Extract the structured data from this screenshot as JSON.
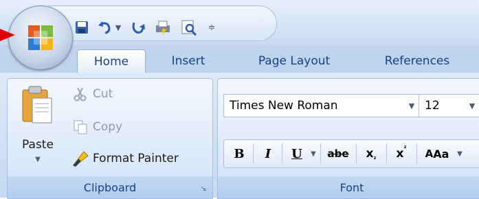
{
  "qat": {
    "save_icon": "save-icon",
    "undo_icon": "undo-icon",
    "redo_icon": "redo-icon",
    "quick_print_icon": "quick-print-icon",
    "print_preview_icon": "print-preview-icon",
    "customize_icon": "customize-qat-icon"
  },
  "tabs": [
    {
      "label": "Home",
      "active": true
    },
    {
      "label": "Insert"
    },
    {
      "label": "Page Layout"
    },
    {
      "label": "References"
    }
  ],
  "clipboard": {
    "paste_label": "Paste",
    "cut_label": "Cut",
    "copy_label": "Copy",
    "format_painter_label": "Format Painter",
    "group_label": "Clipboard"
  },
  "font": {
    "font_name": "Times New Roman",
    "font_size": "12",
    "bold": "B",
    "italic": "I",
    "underline": "U",
    "strikethrough": "abe",
    "subscript": "x",
    "superscript": "x",
    "change_case": "Aa",
    "group_label": "Font"
  },
  "colors": {
    "accent": "#15428b",
    "annotation_arrow": "#e00000"
  }
}
